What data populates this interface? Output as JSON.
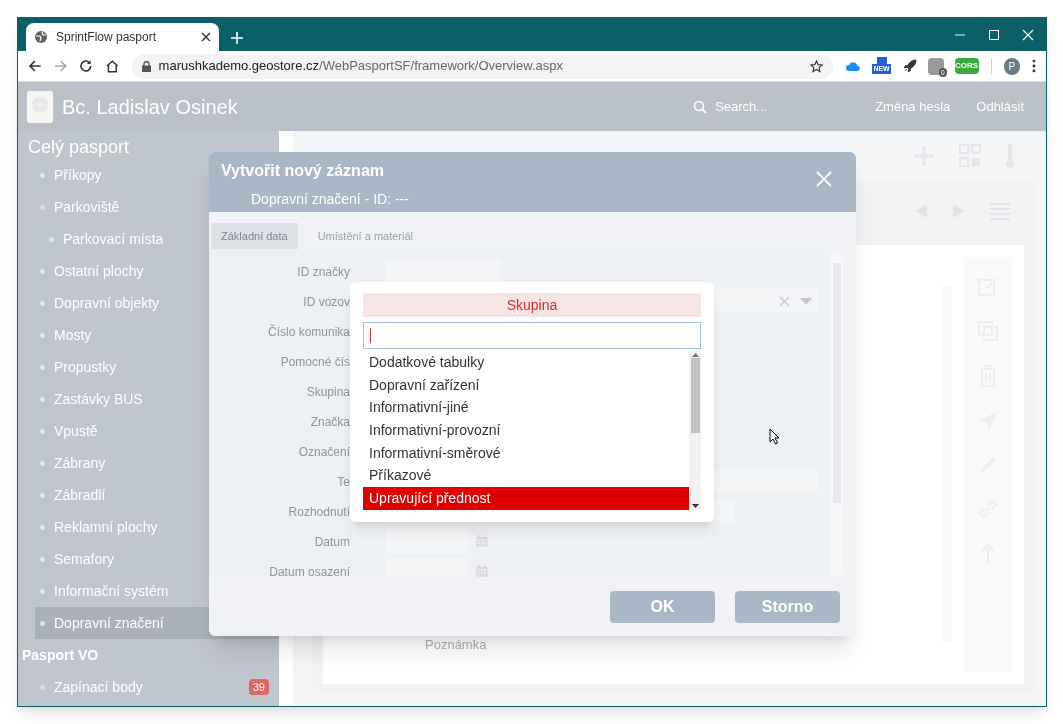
{
  "browser": {
    "tab_title": "SprintFlow pasport",
    "url_host": "marushkademo.geostore.cz",
    "url_path": "/WebPasportSF/framework/Overview.aspx",
    "extensions": [
      {
        "kind": "cloud"
      },
      {
        "kind": "new",
        "badge": "NEW"
      },
      {
        "kind": "rocket"
      },
      {
        "kind": "help",
        "badge": "0"
      },
      {
        "kind": "cors",
        "badge": "CORS"
      }
    ],
    "profile_initial": "P"
  },
  "header": {
    "user": "Bc. Ladislav Osinek",
    "search_placeholder": "Search...",
    "links": [
      "Změna hesla",
      "Odhlásit"
    ]
  },
  "sidebar": {
    "sections": [
      {
        "title": "Celý pasport",
        "items": [
          {
            "label": "Příkopy",
            "color": "#d9eed9",
            "selected": false
          },
          {
            "label": "Parkoviště",
            "color": "#f6d2d2",
            "selected": false,
            "children": [
              {
                "label": "Parkovací místa",
                "color": "#d9eed9",
                "selected": false
              }
            ]
          },
          {
            "label": "Ostatní plochy",
            "color": "#d9eed9",
            "selected": false
          },
          {
            "label": "Dopravní objekty",
            "color": "#d9eed9",
            "selected": false
          },
          {
            "label": "Mosty",
            "color": "#d9eed9",
            "selected": false
          },
          {
            "label": "Propustky",
            "color": "#d9eed9",
            "selected": false
          },
          {
            "label": "Zastávky BUS",
            "color": "#d9eed9",
            "selected": false
          },
          {
            "label": "Vpustě",
            "color": "#d9eed9",
            "selected": false
          },
          {
            "label": "Zábrany",
            "color": "#d9eed9",
            "selected": false
          },
          {
            "label": "Zábradlí",
            "color": "#d9eed9",
            "selected": false
          },
          {
            "label": "Reklamní plochy",
            "color": "#d9eed9",
            "selected": false
          },
          {
            "label": "Semafory",
            "color": "#d9eed9",
            "selected": false
          },
          {
            "label": "Informační systém",
            "color": "#d9eed9",
            "selected": false
          },
          {
            "label": "Dopravní značení",
            "color": "#d9eed9",
            "selected": true
          }
        ]
      },
      {
        "title": "Pasport VO",
        "items": [
          {
            "label": "Zapínací body",
            "color": "#f6d2d2",
            "selected": false,
            "badge": "39"
          }
        ]
      }
    ]
  },
  "main": {
    "note_label": "Poznámka"
  },
  "modal": {
    "title": "Vytvořit nový záznam",
    "subtitle": "Dopravní značení - ID: ---",
    "tabs": [
      {
        "label": "Základní data",
        "selected": true
      },
      {
        "label": "Umístění a materiál",
        "selected": false
      }
    ],
    "fields": [
      {
        "label": "ID značky",
        "kind": "text"
      },
      {
        "label": "ID vozov",
        "kind": "select"
      },
      {
        "label": "Číslo komunika",
        "kind": "none"
      },
      {
        "label": "Pomocné čís",
        "kind": "none"
      },
      {
        "label": "Skupina",
        "kind": "none"
      },
      {
        "label": "Značka",
        "kind": "none"
      },
      {
        "label": "Označení",
        "kind": "none"
      },
      {
        "label": "Te",
        "kind": "text"
      },
      {
        "label": "Rozhodnutí",
        "kind": "text"
      },
      {
        "label": "Datum",
        "kind": "date"
      },
      {
        "label": "Datum osazení",
        "kind": "date"
      }
    ],
    "buttons": [
      "OK",
      "Storno"
    ]
  },
  "popup": {
    "title": "Skupina",
    "options": [
      {
        "label": "Dodatkové tabulky",
        "selected": false
      },
      {
        "label": "Dopravní zařízení",
        "selected": false
      },
      {
        "label": "Informativní-jiné",
        "selected": false
      },
      {
        "label": "Informativní-provozní",
        "selected": false
      },
      {
        "label": "Informativní-směrové",
        "selected": false
      },
      {
        "label": "Příkazové",
        "selected": false
      },
      {
        "label": "Upravující přednost",
        "selected": true
      }
    ]
  }
}
